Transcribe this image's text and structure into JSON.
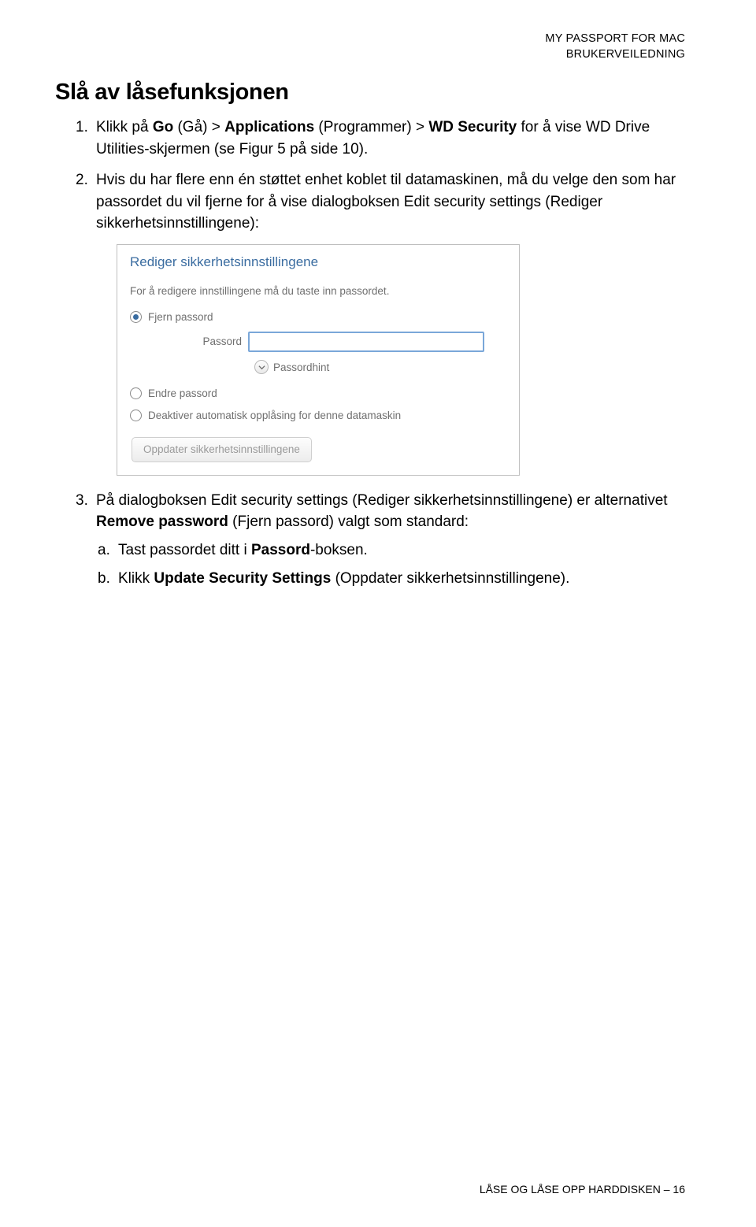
{
  "header": {
    "line1": "MY PASSPORT FOR MAC",
    "line2": "BRUKERVEILEDNING"
  },
  "section": {
    "title": "Slå av låsefunksjonen"
  },
  "steps": {
    "s1": {
      "marker": "1.",
      "pre": "Klikk på ",
      "b1": "Go",
      "mid1": " (Gå) > ",
      "b2": "Applications",
      "mid2": " (Programmer) > ",
      "b3": "WD Security",
      "post": " for å vise WD Drive Utilities-skjermen (se Figur 5 på side 10)."
    },
    "s2": {
      "marker": "2.",
      "text": "Hvis du har flere enn én støttet enhet koblet til datamaskinen, må du velge den som har passordet du vil fjerne for å vise dialogboksen Edit security settings (Rediger sikkerhetsinnstillingene):"
    },
    "s3": {
      "marker": "3.",
      "pre": "På dialogboksen Edit security settings (Rediger sikkerhetsinnstillingene) er alternativet ",
      "b1": "Remove password",
      "post": " (Fjern passord) valgt som standard:",
      "a": {
        "marker": "a.",
        "pre": "Tast passordet ditt i ",
        "b1": "Passord",
        "post": "-boksen."
      },
      "b": {
        "marker": "b.",
        "pre": "Klikk ",
        "b1": "Update Security Settings",
        "post": " (Oppdater sikkerhetsinnstillingene)."
      }
    }
  },
  "dialog": {
    "title": "Rediger sikkerhetsinnstillingene",
    "instr": "For å redigere innstillingene må du taste inn passordet.",
    "opt_remove": "Fjern passord",
    "opt_change": "Endre passord",
    "opt_disable": "Deaktiver automatisk opplåsing for denne datamaskin",
    "field_label": "Passord",
    "field_value": "",
    "hint_label": "Passordhint",
    "button": "Oppdater sikkerhetsinnstillingene"
  },
  "footer": {
    "text": "LÅSE OG LÅSE OPP HARDDISKEN – 16"
  }
}
